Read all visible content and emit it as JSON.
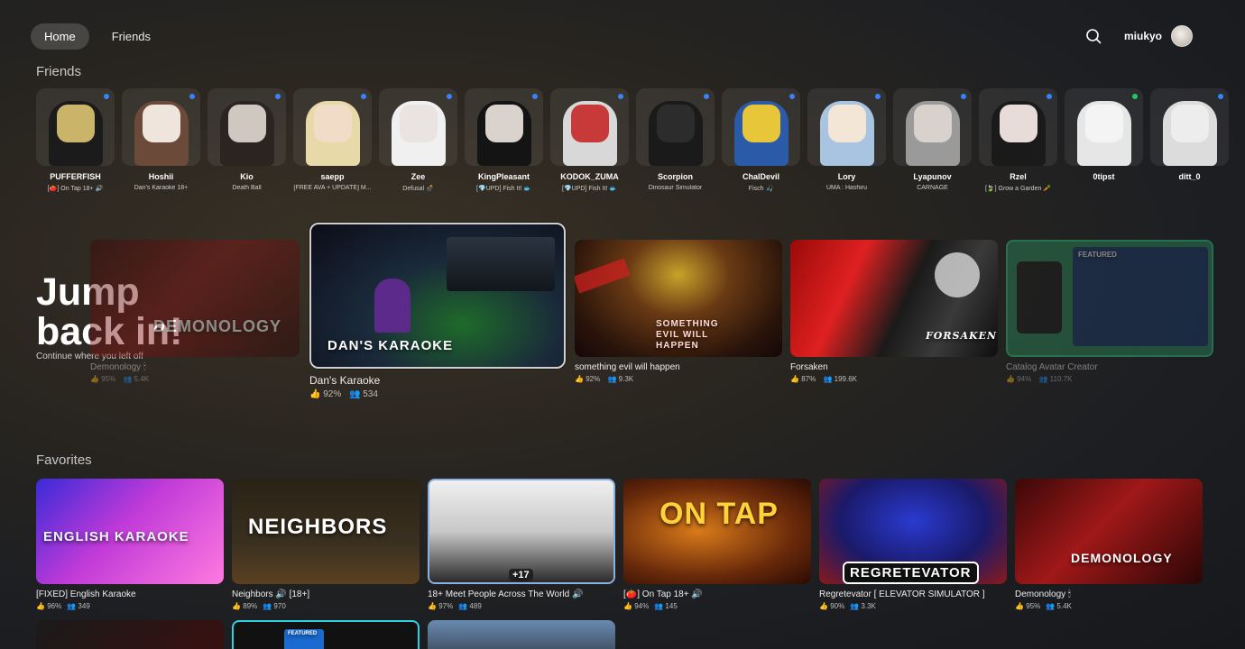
{
  "nav": {
    "home": "Home",
    "friends": "Friends"
  },
  "user": {
    "name": "miukyo"
  },
  "sections": {
    "friends": "Friends",
    "jump_title": "Jump back in!",
    "jump_sub": "Continue where you left off",
    "favorites": "Favorites"
  },
  "friends": [
    {
      "name": "PUFFERFISH",
      "status": "[🍅] On Tap 18+ 🔊",
      "dot": "blue"
    },
    {
      "name": "Hoshii",
      "status": "Dan's Karaoke 18+",
      "dot": "blue"
    },
    {
      "name": "Kio",
      "status": "Death Ball",
      "dot": "blue"
    },
    {
      "name": "saepp",
      "status": "[FREE AVA + UPDATE] M...",
      "dot": "blue"
    },
    {
      "name": "Zee",
      "status": "Defusal 💣",
      "dot": "blue"
    },
    {
      "name": "KingPleasant",
      "status": "[💎UPD] Fish It! 🐟",
      "dot": "blue"
    },
    {
      "name": "KODOK_ZUMA",
      "status": "[💎UPD] Fish It! 🐟",
      "dot": "blue"
    },
    {
      "name": "Scorpion",
      "status": "Dinosaur Simulator",
      "dot": "blue"
    },
    {
      "name": "ChalDevil",
      "status": "Fisch 🎣",
      "dot": "blue"
    },
    {
      "name": "Lory",
      "status": "UMA : Hashiru",
      "dot": "blue"
    },
    {
      "name": "Lyapunov",
      "status": "CARNAGE",
      "dot": "blue"
    },
    {
      "name": "Rzel",
      "status": "[🍃] Grow a Garden 🥕",
      "dot": "blue"
    },
    {
      "name": "0tipst",
      "status": "",
      "dot": "green"
    },
    {
      "name": "ditt_0",
      "status": "",
      "dot": "blue"
    }
  ],
  "jump": [
    {
      "name": "Demonology 🕯",
      "rating": "95%",
      "players": "5.4K",
      "thumb_label": "DEMONOLOGY"
    },
    {
      "name": "Dan's Karaoke",
      "rating": "92%",
      "players": "534",
      "thumb_label": "DAN'S KARAOKE"
    },
    {
      "name": "something evil will happen",
      "rating": "92%",
      "players": "9.3K",
      "thumb_label": "SOMETHING EVIL WILL HAPPEN"
    },
    {
      "name": "Forsaken",
      "rating": "87%",
      "players": "199.6K",
      "thumb_label": "FORSAKEN"
    },
    {
      "name": "Catalog Avatar Creator",
      "rating": "94%",
      "players": "110.7K",
      "thumb_label": "FEATURED"
    }
  ],
  "favorites": [
    {
      "name": "[FIXED] English Karaoke",
      "rating": "96%",
      "players": "349",
      "thumb_label": "ENGLISH KARAOKE"
    },
    {
      "name": "Neighbors 🔊 [18+]",
      "rating": "89%",
      "players": "970",
      "thumb_label": "NEIGHBORS"
    },
    {
      "name": "18+ Meet People Across The World 🔊",
      "rating": "97%",
      "players": "489",
      "thumb_label": "+17"
    },
    {
      "name": "[🍅] On Tap 18+ 🔊",
      "rating": "94%",
      "players": "145",
      "thumb_label": "ON TAP"
    },
    {
      "name": "Regretevator [ ELEVATOR SIMULATOR ]",
      "rating": "90%",
      "players": "3.3K",
      "thumb_label": "REGRETEVATOR"
    },
    {
      "name": "Demonology 🕯",
      "rating": "95%",
      "players": "5.4K",
      "thumb_label": "DEMONOLOGY"
    }
  ],
  "row3_labels": [
    "FEATURED"
  ],
  "icons": {
    "search": "search-icon",
    "thumbs_up": "thumbs-up-icon",
    "players": "players-icon"
  },
  "colors": {
    "online_dot": "#3a82f6",
    "ingame_dot": "#22c55e",
    "featured_border": "#cfcfcf"
  }
}
